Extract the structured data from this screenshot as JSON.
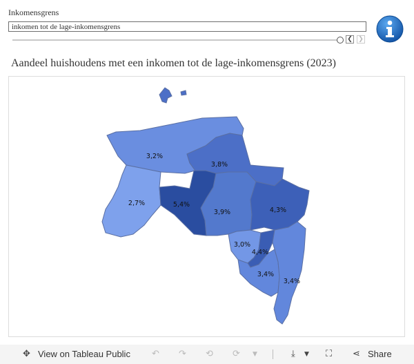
{
  "filter": {
    "label": "Inkomensgrens",
    "selected": "inkomen tot de lage-inkomensgrens"
  },
  "slider": {
    "position_fraction": 1.0,
    "prev_symbol": "❮",
    "next_symbol": "❯"
  },
  "title": "Aandeel huishoudens met een inkomen tot de lage-inkomensgrens (2023)",
  "map": {
    "regions": [
      {
        "label": "3,2%",
        "value": 3.2,
        "color": "#6a8ee0"
      },
      {
        "label": "3,8%",
        "value": 3.8,
        "color": "#4c6fc7"
      },
      {
        "label": "2,7%",
        "value": 2.7,
        "color": "#7ea1ec"
      },
      {
        "label": "5,4%",
        "value": 5.4,
        "color": "#2a4da0"
      },
      {
        "label": "3,9%",
        "value": 3.9,
        "color": "#5379cd"
      },
      {
        "label": "4,3%",
        "value": 4.3,
        "color": "#3d60b8"
      },
      {
        "label": "3,0%",
        "value": 3.0,
        "color": "#7397e6"
      },
      {
        "label": "4,4%",
        "value": 4.4,
        "color": "#3a5db4"
      },
      {
        "label": "3,4%",
        "value": 3.4,
        "color": "#6287dc"
      },
      {
        "label": "3,4%",
        "value": 3.4,
        "color": "#6287dc"
      }
    ],
    "island_color": "#4c6fc7"
  },
  "toolbar": {
    "view_label": "View on Tableau Public",
    "share_label": "Share",
    "icons": [
      "tableau-icon",
      "undo-icon",
      "redo-icon",
      "revert-icon",
      "refresh-icon",
      "download-icon",
      "fullscreen-icon",
      "share-icon"
    ]
  },
  "colors": {
    "info_blue": "#1f6fc9",
    "border": "#5a6fa3"
  }
}
